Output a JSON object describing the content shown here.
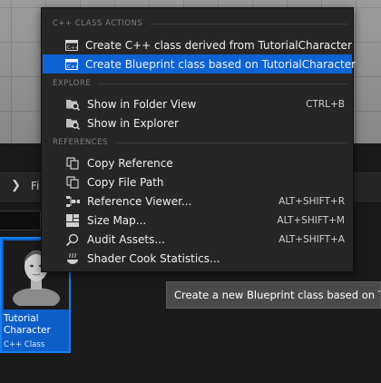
{
  "content_browser": {
    "path_text": "Fi",
    "asset": {
      "name": "Tutorial Character",
      "type": "C++ Class"
    }
  },
  "tooltip": {
    "text": "Create a new Blueprint class based on TutorialCharacter"
  },
  "context_menu": {
    "sections": [
      {
        "title": "C++ CLASS ACTIONS"
      },
      {
        "title": "EXPLORE"
      },
      {
        "title": "REFERENCES"
      }
    ],
    "items": [
      {
        "label": "Create C++ class derived from TutorialCharacter",
        "shortcut": "",
        "icon": "cpp-class-icon"
      },
      {
        "label": "Create Blueprint class based on TutorialCharacter",
        "shortcut": "",
        "icon": "blueprint-class-icon",
        "selected": true
      },
      {
        "label": "Show in Folder View",
        "shortcut": "CTRL+B",
        "icon": "folder-search-icon"
      },
      {
        "label": "Show in Explorer",
        "shortcut": "",
        "icon": "folder-search-icon"
      },
      {
        "label": "Copy Reference",
        "shortcut": "",
        "icon": "copy-icon"
      },
      {
        "label": "Copy File Path",
        "shortcut": "",
        "icon": "copy-icon"
      },
      {
        "label": "Reference Viewer...",
        "shortcut": "ALT+SHIFT+R",
        "icon": "reference-viewer-icon"
      },
      {
        "label": "Size Map...",
        "shortcut": "ALT+SHIFT+M",
        "icon": "size-map-icon"
      },
      {
        "label": "Audit Assets...",
        "shortcut": "ALT+SHIFT+A",
        "icon": "audit-icon"
      },
      {
        "label": "Shader Cook Statistics...",
        "shortcut": "",
        "icon": "shader-stats-icon"
      }
    ]
  },
  "colors": {
    "menu_bg": "#262626",
    "selection": "#0d63d4",
    "asset_tile": "#0d5ec7"
  }
}
